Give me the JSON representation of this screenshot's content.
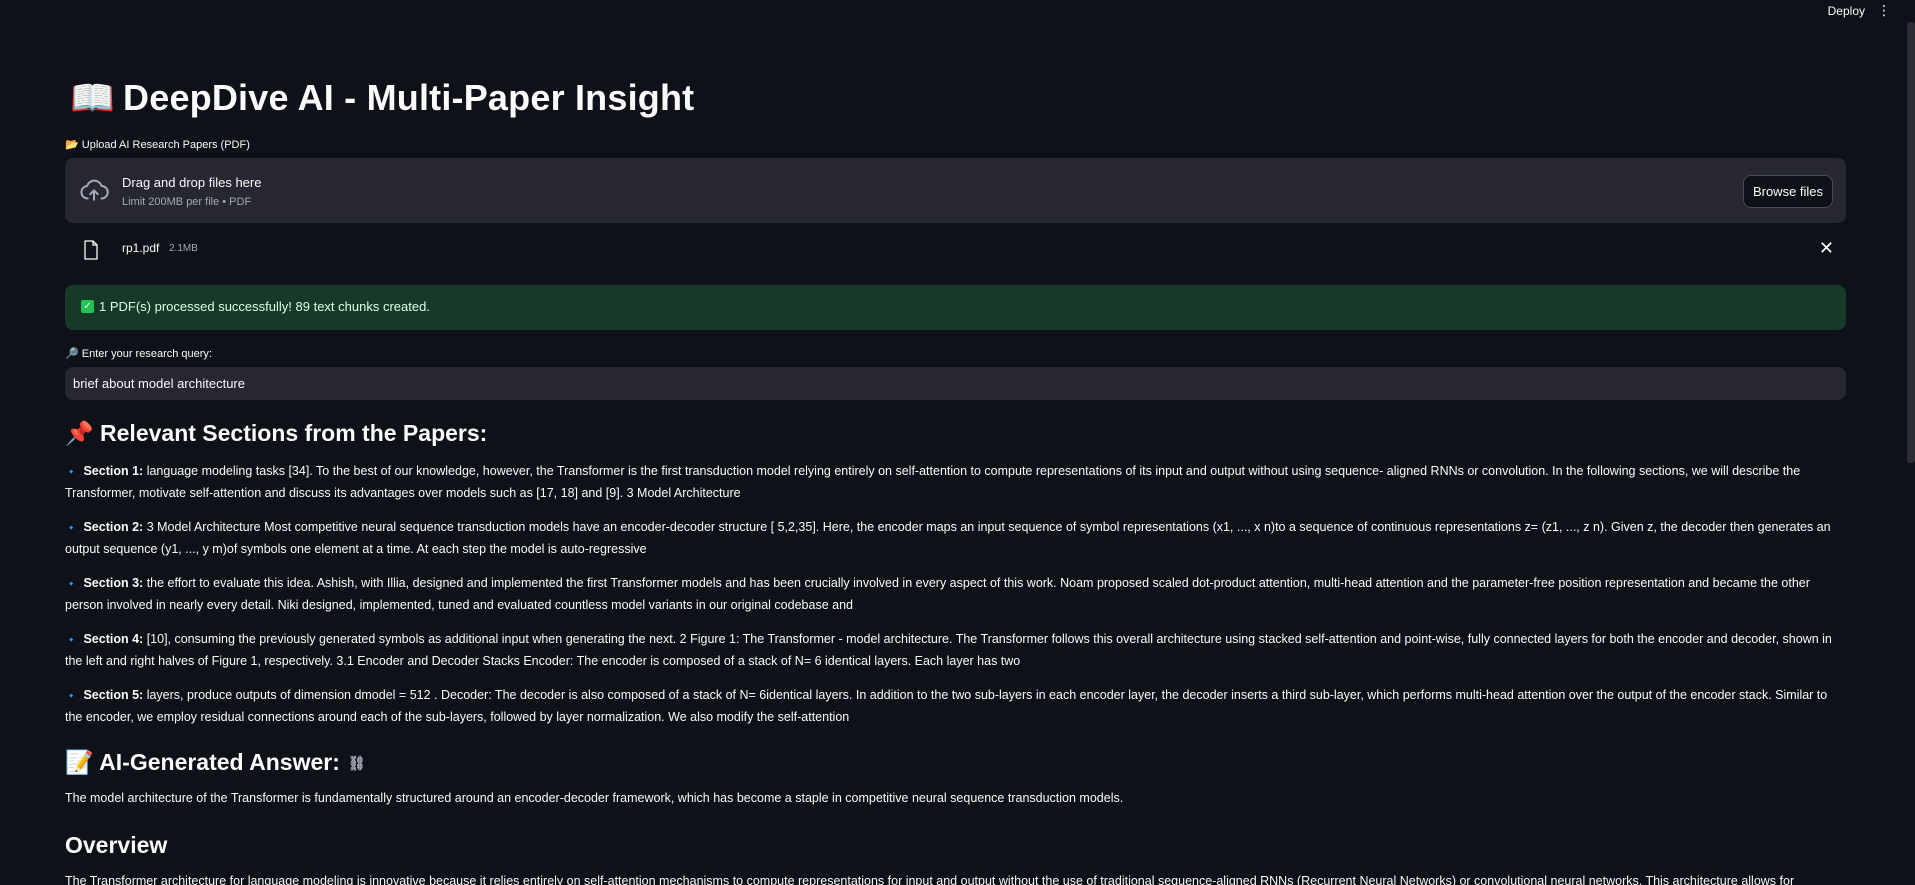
{
  "topbar": {
    "deploy_label": "Deploy",
    "menu_icon": "⋮"
  },
  "title": {
    "emoji": "📖",
    "text": "DeepDive AI - Multi-Paper Insight"
  },
  "upload": {
    "label": "📂 Upload AI Research Papers (PDF)",
    "drop_text": "Drag and drop files here",
    "limit_text": "Limit 200MB per file • PDF",
    "browse_label": "Browse files"
  },
  "file": {
    "name": "rp1.pdf",
    "size": "2.1MB"
  },
  "status": {
    "message": "1 PDF(s) processed successfully! 89 text chunks created."
  },
  "query": {
    "label": "🔎 Enter your research query:",
    "value": "brief about model architecture"
  },
  "relevant": {
    "heading": "📌 Relevant Sections from the Papers:",
    "sections": [
      {
        "label": "Section 1:",
        "text": "language modeling tasks [34]. To the best of our knowledge, however, the Transformer is the first transduction model relying entirely on self-attention to compute representations of its input and output without using sequence- aligned RNNs or convolution. In the following sections, we will describe the Transformer, motivate self-attention and discuss its advantages over models such as [17, 18] and [9]. 3 Model Architecture"
      },
      {
        "label": "Section 2:",
        "text": "3 Model Architecture Most competitive neural sequence transduction models have an encoder-decoder structure [ 5,2,35]. Here, the encoder maps an input sequence of symbol representations (x1, ..., x n)to a sequence of continuous representations z= (z1, ..., z n). Given z, the decoder then generates an output sequence (y1, ..., y m)of symbols one element at a time. At each step the model is auto-regressive"
      },
      {
        "label": "Section 3:",
        "text": "the effort to evaluate this idea. Ashish, with Illia, designed and implemented the first Transformer models and has been crucially involved in every aspect of this work. Noam proposed scaled dot-product attention, multi-head attention and the parameter-free position representation and became the other person involved in nearly every detail. Niki designed, implemented, tuned and evaluated countless model variants in our original codebase and"
      },
      {
        "label": "Section 4:",
        "text": "[10], consuming the previously generated symbols as additional input when generating the next. 2 Figure 1: The Transformer - model architecture. The Transformer follows this overall architecture using stacked self-attention and point-wise, fully connected layers for both the encoder and decoder, shown in the left and right halves of Figure 1, respectively. 3.1 Encoder and Decoder Stacks Encoder: The encoder is composed of a stack of N= 6 identical layers. Each layer has two"
      },
      {
        "label": "Section 5:",
        "text": "layers, produce outputs of dimension dmodel = 512 . Decoder: The decoder is also composed of a stack of N= 6identical layers. In addition to the two sub-layers in each encoder layer, the decoder inserts a third sub-layer, which performs multi-head attention over the output of the encoder stack. Similar to the encoder, we employ residual connections around each of the sub-layers, followed by layer normalization. We also modify the self-attention"
      }
    ]
  },
  "answer": {
    "heading": "📝 AI-Generated Answer:",
    "link_icon": "⛓",
    "text": "The model architecture of the Transformer is fundamentally structured around an encoder-decoder framework, which has become a staple in competitive neural sequence transduction models.",
    "overview_heading": "Overview",
    "overview_text": "The Transformer architecture for language modeling is innovative because it relies entirely on self-attention mechanisms to compute representations for input and output without the use of traditional sequence-aligned RNNs (Recurrent Neural Networks) or convolutional neural networks. This architecture allows for"
  }
}
